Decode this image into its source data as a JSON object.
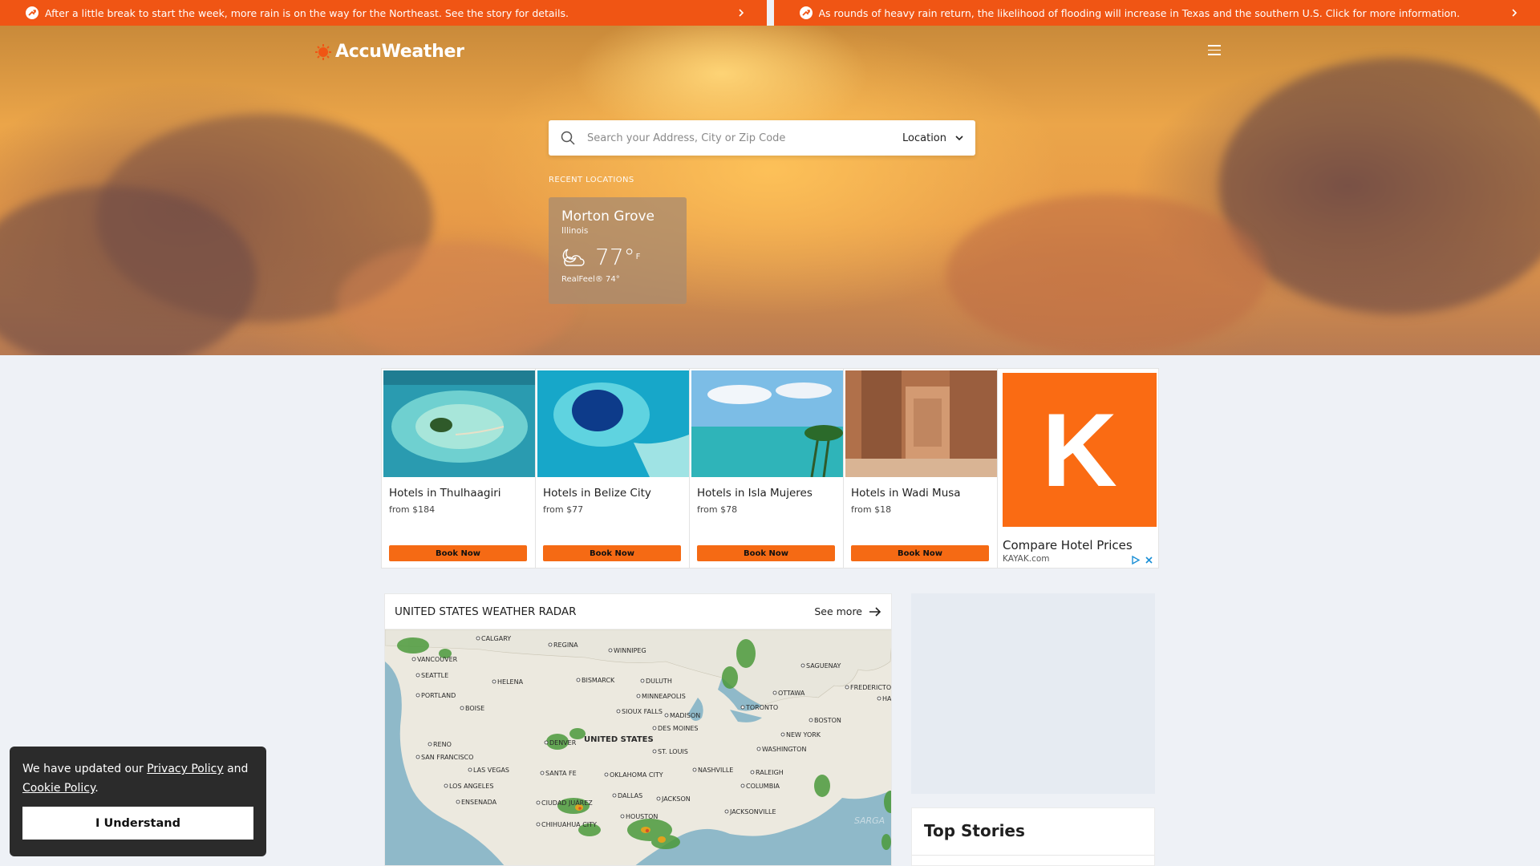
{
  "alerts": [
    {
      "text": "After a little break to start the week, more rain is on the way for the Northeast. See the story for details.",
      "icon": "alert-arrow-icon"
    },
    {
      "text": "As rounds of heavy rain return, the likelihood of flooding will increase in Texas and the southern U.S. Click for more information.",
      "icon": "alert-arrow-icon"
    }
  ],
  "header": {
    "brand": "AccuWeather"
  },
  "search": {
    "placeholder": "Search your Address, City or Zip Code",
    "location_label": "Location"
  },
  "recent": {
    "label": "RECENT LOCATIONS",
    "items": [
      {
        "city": "Morton Grove",
        "state": "Illinois",
        "temp": "77°",
        "unit": "F",
        "realfeel": "RealFeel® 74°",
        "icon": "partly-cloudy-night-icon"
      }
    ]
  },
  "ad": {
    "hotels": [
      {
        "name": "Hotels in Thulhaagiri",
        "price": "from $184",
        "button": "Book Now"
      },
      {
        "name": "Hotels in Belize City",
        "price": "from $77",
        "button": "Book Now"
      },
      {
        "name": "Hotels in Isla Mujeres",
        "price": "from $78",
        "button": "Book Now"
      },
      {
        "name": "Hotels in Wadi Musa",
        "price": "from $18",
        "button": "Book Now"
      }
    ],
    "kayak": {
      "letter": "K",
      "title": "Compare Hotel Prices",
      "domain": "KAYAK.com"
    }
  },
  "radar": {
    "title": "UNITED STATES WEATHER RADAR",
    "see_more": "See more",
    "labels": [
      "CALGARY",
      "REGINA",
      "WINNIPEG",
      "VANCOUVER",
      "SEATTLE",
      "HELENA",
      "BISMARCK",
      "DULUTH",
      "SAGUENAY",
      "FREDERICTON",
      "HALIFAX",
      "OTTAWA",
      "PORTLAND",
      "MINNEAPOLIS",
      "TORONTO",
      "BOISE",
      "SIOUX FALLS",
      "MADISON",
      "BOSTON",
      "DES MOINES",
      "NEW YORK",
      "RENO",
      "DENVER",
      "UNITED STATES",
      "WASHINGTON",
      "SAN FRANCISCO",
      "ST. LOUIS",
      "LAS VEGAS",
      "NASHVILLE",
      "RALEIGH",
      "SANTA FE",
      "OKLAHOMA CITY",
      "LOS ANGELES",
      "COLUMBIA",
      "DALLAS",
      "JACKSON",
      "ENSENADA",
      "CIUDAD JUÁREZ",
      "JACKSONVILLE",
      "HOUSTON",
      "CHIHUAHUA CITY",
      "SARGA"
    ]
  },
  "top_stories": {
    "title": "Top Stories"
  },
  "cookie": {
    "prefix": "We have updated our ",
    "privacy_link": "Privacy Policy",
    "middle": " and ",
    "cookie_link": "Cookie Policy",
    "suffix": ".",
    "button": "I Understand"
  },
  "colors": {
    "accent": "#f05514",
    "kayak": "#fa6b13",
    "book_button": "#f56a14"
  }
}
